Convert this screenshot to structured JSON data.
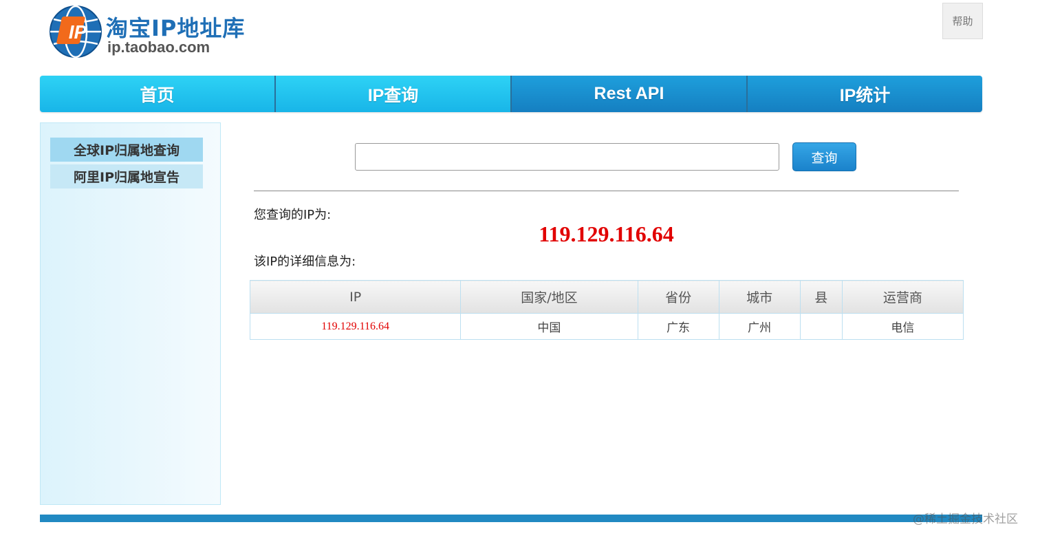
{
  "header": {
    "logo_title": "淘宝IP地址库",
    "logo_domain": "ip.taobao.com",
    "logo_badge": "IP",
    "help_label": "帮助"
  },
  "nav": {
    "items": [
      {
        "label": "首页"
      },
      {
        "label": "IP查询"
      },
      {
        "label": "Rest API"
      },
      {
        "label": "IP统计"
      }
    ]
  },
  "sidebar": {
    "items": [
      {
        "label": "全球IP归属地查询",
        "active": true
      },
      {
        "label": "阿里IP归属地宣告",
        "active": false
      }
    ]
  },
  "search": {
    "value": "",
    "placeholder": "",
    "button_label": "查询"
  },
  "result": {
    "ip_label": "您查询的IP为:",
    "ip_value": "119.129.116.64",
    "detail_label": "该IP的详细信息为:"
  },
  "table": {
    "headers": [
      "IP",
      "国家/地区",
      "省份",
      "城市",
      "县",
      "运营商"
    ],
    "row": [
      "119.129.116.64",
      "中国",
      "广东",
      "广州",
      "",
      "电信"
    ]
  },
  "watermark": "@稀土掘金技术社区",
  "colors": {
    "nav_light": "#18b5e8",
    "nav_dark": "#157fc1",
    "ip_red": "#e10000",
    "footer_bar": "#2189c2"
  }
}
